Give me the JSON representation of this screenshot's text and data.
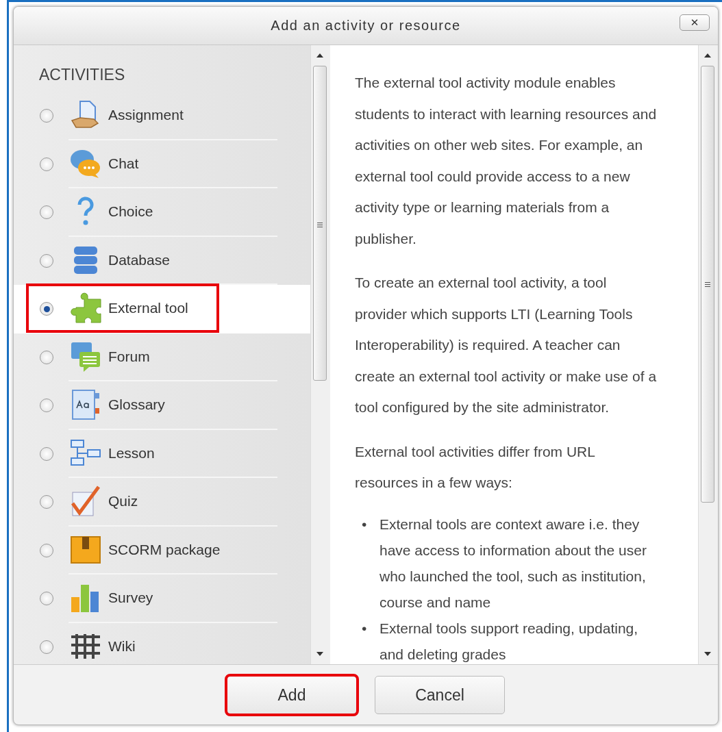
{
  "dialog": {
    "title": "Add an activity or resource",
    "close_label": "✕"
  },
  "activities": {
    "heading": "ACTIVITIES",
    "items": [
      {
        "label": "Assignment",
        "kind": "assignment",
        "selected": false,
        "highlighted": false
      },
      {
        "label": "Chat",
        "kind": "chat",
        "selected": false,
        "highlighted": false
      },
      {
        "label": "Choice",
        "kind": "choice",
        "selected": false,
        "highlighted": false
      },
      {
        "label": "Database",
        "kind": "database",
        "selected": false,
        "highlighted": false
      },
      {
        "label": "External tool",
        "kind": "puzzle",
        "selected": true,
        "highlighted": true
      },
      {
        "label": "Forum",
        "kind": "forum",
        "selected": false,
        "highlighted": false
      },
      {
        "label": "Glossary",
        "kind": "glossary",
        "selected": false,
        "highlighted": false
      },
      {
        "label": "Lesson",
        "kind": "lesson",
        "selected": false,
        "highlighted": false
      },
      {
        "label": "Quiz",
        "kind": "quiz",
        "selected": false,
        "highlighted": false
      },
      {
        "label": "SCORM package",
        "kind": "scorm",
        "selected": false,
        "highlighted": false
      },
      {
        "label": "Survey",
        "kind": "survey",
        "selected": false,
        "highlighted": false
      },
      {
        "label": "Wiki",
        "kind": "wiki",
        "selected": false,
        "highlighted": false
      }
    ]
  },
  "description": {
    "paragraphs": [
      "The external tool activity module enables students to interact with learning resources and activities on other web sites. For example, an external tool could provide access to a new activity type or learning materials from a publisher.",
      "To create an external tool activity, a tool provider which supports LTI (Learning Tools Interoperability) is required. A teacher can create an external tool activity or make use of a tool configured by the site administrator.",
      "External tool activities differ from URL resources in a few ways:"
    ],
    "bullet_marker": "•",
    "bullets": [
      "External tools are context aware i.e. they have access to information about the user who launched the tool, such as institution, course and name",
      "External tools support reading, updating, and deleting grades"
    ]
  },
  "buttons": [
    {
      "label": "Add",
      "highlighted": true
    },
    {
      "label": "Cancel",
      "highlighted": false
    }
  ]
}
